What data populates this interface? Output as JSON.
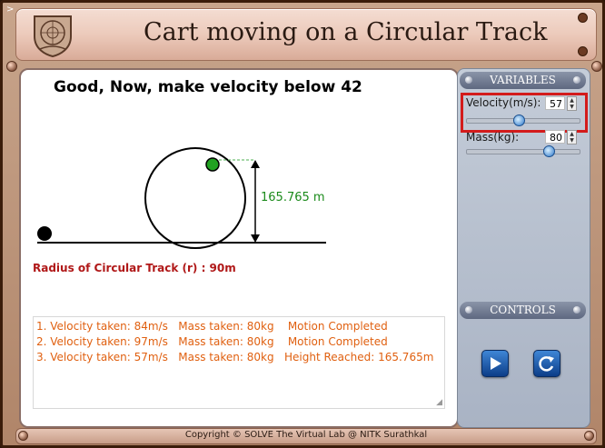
{
  "app": {
    "title": "Cart moving on a Circular Track",
    "corner_mark": ">",
    "logo": {
      "icon": "institute-seal-logo"
    }
  },
  "simulation": {
    "instruction": "Good, Now, make velocity below 42",
    "height_label": "165.765 m",
    "radius_label": "Radius of Circular Track (r) : 90m"
  },
  "log": {
    "rows": [
      "1. Velocity taken: 84m/s   Mass taken: 80kg    Motion Completed",
      "2. Velocity taken: 97m/s   Mass taken: 80kg    Motion Completed",
      "3. Velocity taken: 57m/s   Mass taken: 80kg   Height Reached: 165.765m"
    ]
  },
  "variables": {
    "header": "VARIABLES",
    "velocity": {
      "label": "Velocity(m/s):",
      "value": "57",
      "slider_fraction": 0.46
    },
    "mass": {
      "label": "Mass(kg):",
      "value": "80",
      "slider_fraction": 0.76
    }
  },
  "controls": {
    "header": "CONTROLS",
    "play_icon": "play-icon",
    "reset_icon": "reset-icon"
  },
  "footer": {
    "copyright": "Copyright © SOLVE The Virtual Lab @ NITK Surathkal"
  },
  "colors": {
    "frame": "#b08569",
    "accent_red": "#d31b1b",
    "log_text": "#e06010",
    "height_text": "#1a8a1a",
    "button_blue": "#1f5fb0"
  }
}
